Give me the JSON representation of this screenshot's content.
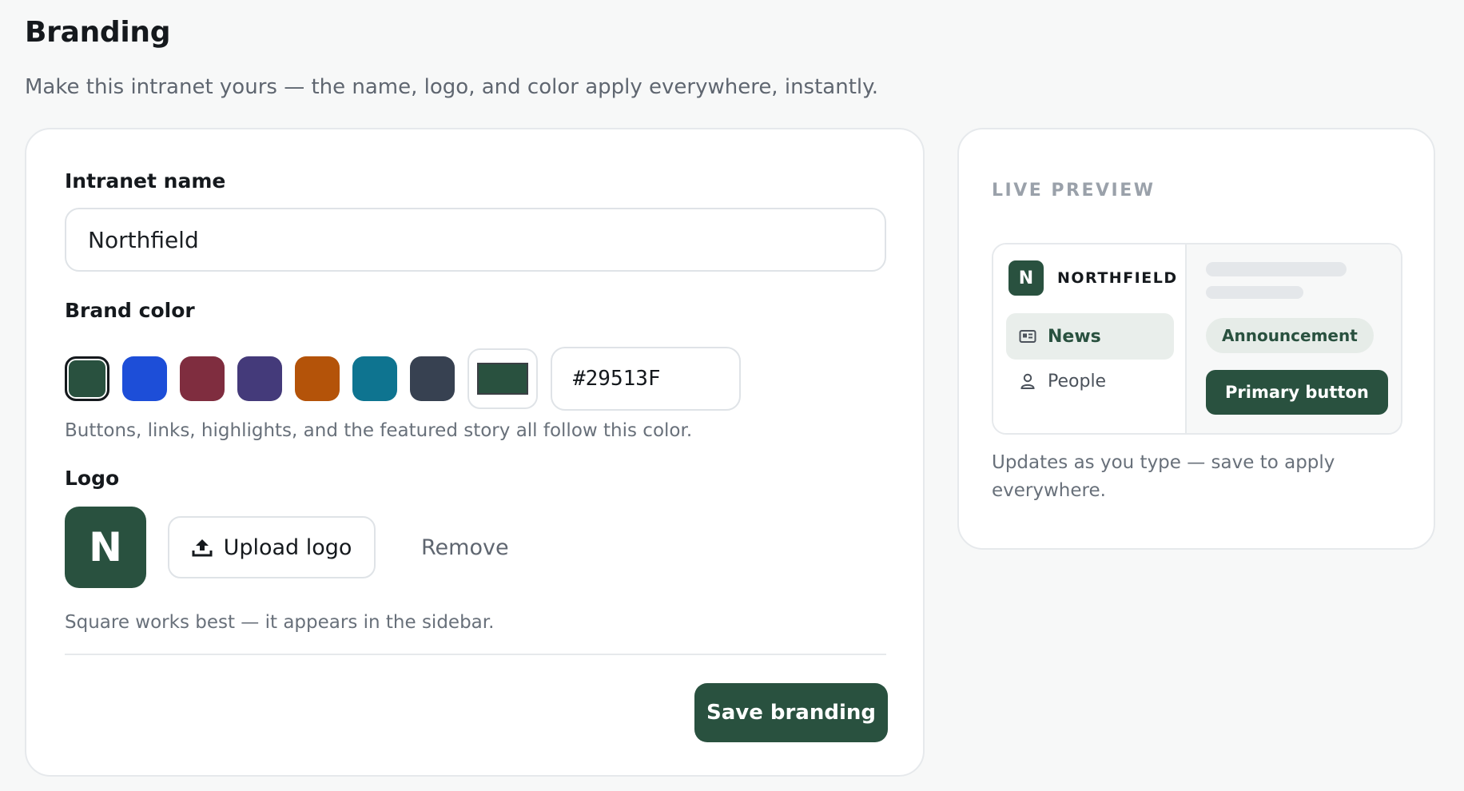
{
  "header": {
    "title": "Branding",
    "subtitle": "Make this intranet yours — the name, logo, and color apply everywhere, instantly."
  },
  "form": {
    "name_label": "Intranet name",
    "name_value": "Northfield",
    "color_label": "Brand color",
    "swatches": [
      "#29513f",
      "#1d4ed8",
      "#7f2d3f",
      "#443a7a",
      "#b45309",
      "#0e7490",
      "#374151"
    ],
    "selected_swatch_index": 0,
    "hex_value": "#29513F",
    "color_hint": "Buttons, links, highlights, and the featured story all follow this color.",
    "logo_label": "Logo",
    "logo_letter": "N",
    "upload_label": "Upload logo",
    "remove_label": "Remove",
    "logo_hint": "Square works best — it appears in the sidebar.",
    "save_label": "Save branding"
  },
  "preview": {
    "eyebrow": "LIVE PREVIEW",
    "logo_letter": "N",
    "app_name": "NORTHFIELD",
    "nav": [
      {
        "label": "News",
        "icon": "newspaper-icon",
        "active": true
      },
      {
        "label": "People",
        "icon": "person-icon",
        "active": false
      }
    ],
    "badge_label": "Announcement",
    "primary_button_label": "Primary button",
    "note": "Updates as you type — save to apply everywhere."
  },
  "colors": {
    "brand": "#29513f",
    "background": "#f7f8f8",
    "muted_text": "#68707a"
  }
}
